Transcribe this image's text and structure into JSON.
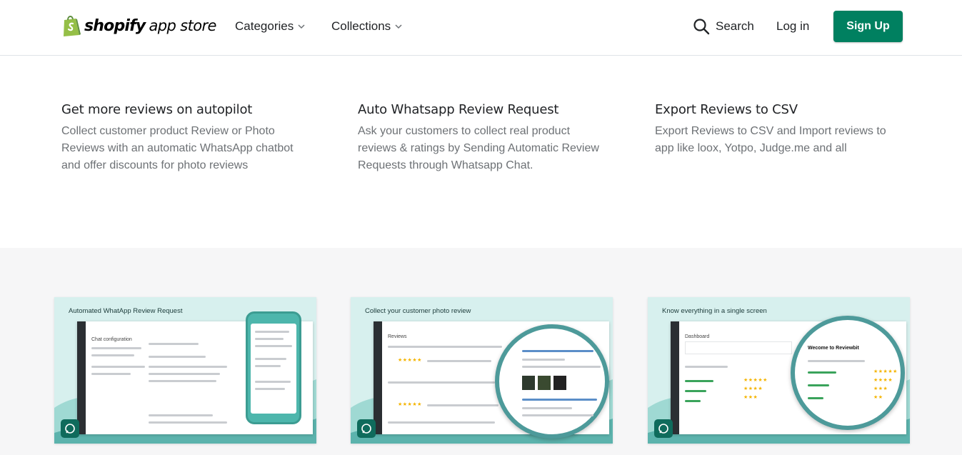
{
  "header": {
    "logo_word": "shopify",
    "logo_sub": "app store",
    "nav": [
      {
        "label": "Categories"
      },
      {
        "label": "Collections"
      }
    ],
    "search_label": "Search",
    "login_label": "Log in",
    "signup_label": "Sign Up",
    "accent_color": "#008060"
  },
  "features": [
    {
      "title": "Get more reviews on autopilot",
      "body": "Collect customer product Review or Photo Reviews with an automatic WhatsApp chatbot and offer discounts for photo reviews"
    },
    {
      "title": "Auto Whatsapp Review Request",
      "body": "Ask your customers to collect real product reviews & ratings by Sending Automatic Review Requests through Whatsapp Chat."
    },
    {
      "title": "Export Reviews to CSV",
      "body": "Export Reviews to CSV and Import reviews to app like loox, Yotpo, Judge.me and all"
    }
  ],
  "gallery": [
    {
      "caption": "Automated WhatApp Review Request",
      "screen_title": "Chat configuration"
    },
    {
      "caption": "Collect your customer photo review",
      "screen_title": "Reviews"
    },
    {
      "caption": "Know everything in a single screen",
      "screen_title": "Dashboard",
      "zoom_title": "Wecome to Reviewbit"
    }
  ]
}
